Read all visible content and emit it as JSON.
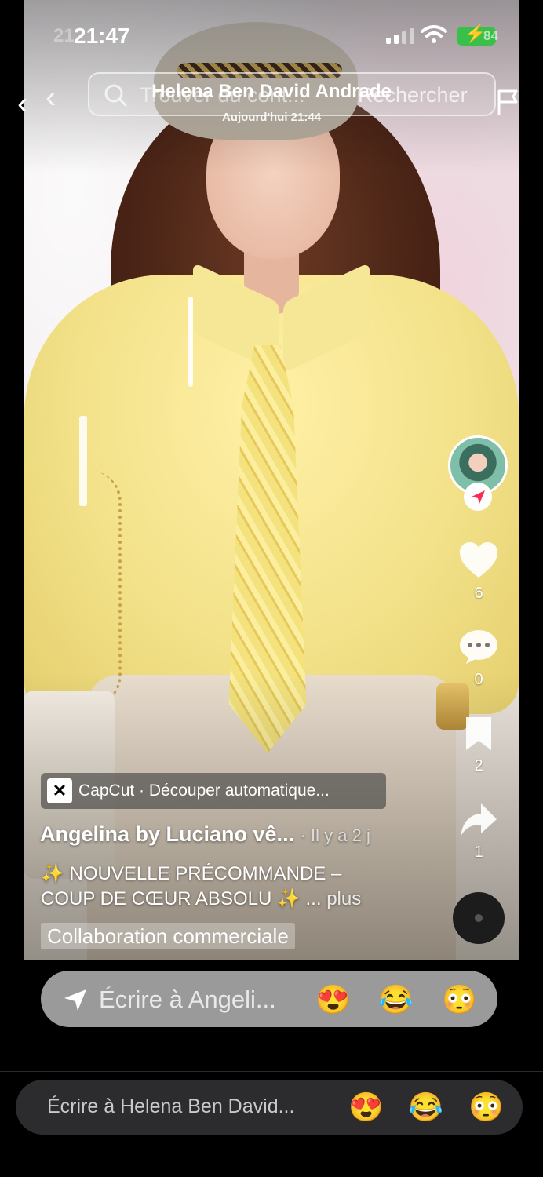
{
  "status": {
    "time": "21:47",
    "time_ghost": "21",
    "battery": "84"
  },
  "header": {
    "search_placeholder": "Trouver du cont...",
    "search_action": "Rechercher",
    "chat_title": "Helena Ben David Andrade",
    "chat_subtitle": "Aujourd'hui 21:44"
  },
  "video": {
    "likes": "6",
    "comments": "0",
    "saves": "2",
    "shares": "1",
    "capcut_label": "CapCut · Découper automatique...",
    "author": "Angelina by Luciano vê...",
    "posted": "· Il y a 2 j",
    "caption_line1": "✨ NOUVELLE PRÉCOMMANDE –",
    "caption_line2": "COUP DE CŒUR ABSOLU ✨ ...",
    "caption_more": "plus",
    "collab_label": "Collaboration commerciale"
  },
  "reply_video": {
    "placeholder": "Écrire à Angeli...",
    "emojis": [
      "😍",
      "😂",
      "😳"
    ]
  },
  "reply_chat": {
    "placeholder": "Écrire à Helena Ben David...",
    "emojis": [
      "😍",
      "😂",
      "😳"
    ]
  },
  "colors": {
    "accent_red": "#fe2c55",
    "battery_green": "#3ac04a"
  }
}
